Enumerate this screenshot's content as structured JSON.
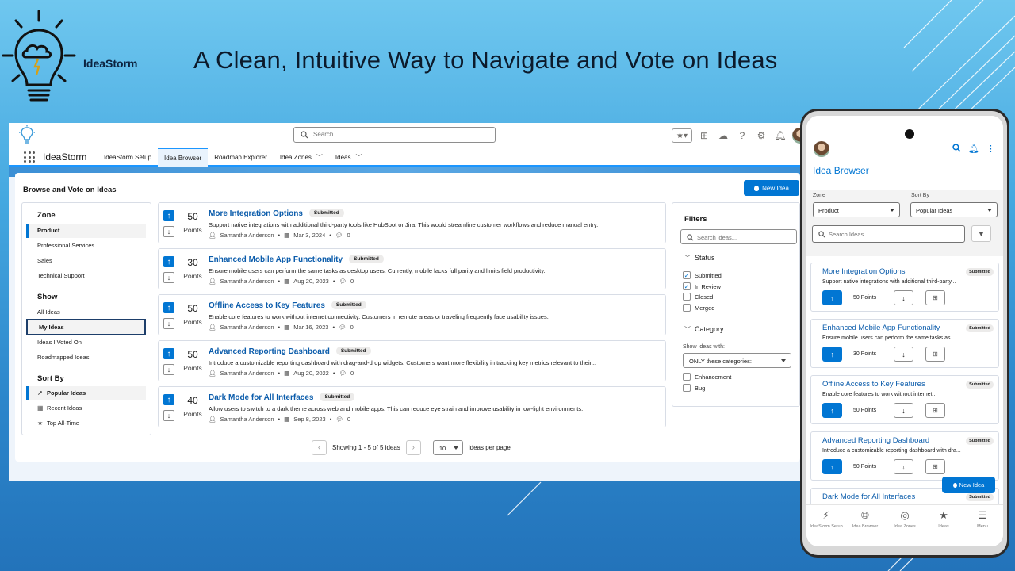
{
  "brand": {
    "name": "IdeaStorm",
    "logo_icon": "lightbulb-cloud-icon"
  },
  "headline": "A Clean, Intuitive Way to Navigate and Vote on Ideas",
  "desktop": {
    "search_placeholder": "Search...",
    "app_name": "IdeaStorm",
    "tabs": [
      {
        "label": "IdeaStorm Setup",
        "active": false
      },
      {
        "label": "Idea Browser",
        "active": true
      },
      {
        "label": "Roadmap Explorer",
        "active": false
      },
      {
        "label": "Idea Zones",
        "active": false,
        "dropdown": true
      },
      {
        "label": "Ideas",
        "active": false,
        "dropdown": true
      }
    ],
    "page_title": "Browse and Vote on Ideas",
    "new_idea_label": "New Idea",
    "zone": {
      "heading": "Zone",
      "items": [
        "Product",
        "Professional Services",
        "Sales",
        "Technical Support"
      ],
      "selected": "Product"
    },
    "show": {
      "heading": "Show",
      "items": [
        "All Ideas",
        "My Ideas",
        "Ideas I Voted On",
        "Roadmapped Ideas"
      ],
      "selected": "My Ideas"
    },
    "sort": {
      "heading": "Sort By",
      "items": [
        "Popular Ideas",
        "Recent Ideas",
        "Top All-Time"
      ],
      "selected": "Popular Ideas"
    },
    "ideas": [
      {
        "points": "50",
        "points_label": "Points",
        "title": "More Integration Options",
        "status": "Submitted",
        "description": "Support native integrations with additional third-party tools like HubSpot or Jira. This would streamline customer workflows and reduce manual entry.",
        "author": "Samantha Anderson",
        "date": "Mar 3, 2024",
        "comments": "0"
      },
      {
        "points": "30",
        "points_label": "Points",
        "title": "Enhanced Mobile App Functionality",
        "status": "Submitted",
        "description": "Ensure mobile users can perform the same tasks as desktop users. Currently, mobile lacks full parity and limits field productivity.",
        "author": "Samantha Anderson",
        "date": "Aug 20, 2023",
        "comments": "0"
      },
      {
        "points": "50",
        "points_label": "Points",
        "title": "Offline Access to Key Features",
        "status": "Submitted",
        "description": "Enable core features to work without internet connectivity. Customers in remote areas or traveling frequently face usability issues.",
        "author": "Samantha Anderson",
        "date": "Mar 16, 2023",
        "comments": "0"
      },
      {
        "points": "50",
        "points_label": "Points",
        "title": "Advanced Reporting Dashboard",
        "status": "Submitted",
        "description": "Introduce a customizable reporting dashboard with drag-and-drop widgets. Customers want more flexibility in tracking key metrics relevant to their...",
        "author": "Samantha Anderson",
        "date": "Aug 20, 2022",
        "comments": "0"
      },
      {
        "points": "40",
        "points_label": "Points",
        "title": "Dark Mode for All Interfaces",
        "status": "Submitted",
        "description": "Allow users to switch to a dark theme across web and mobile apps. This can reduce eye strain and improve usability in low-light environments.",
        "author": "Samantha Anderson",
        "date": "Sep 8, 2023",
        "comments": "0"
      }
    ],
    "pager": {
      "showing": "Showing 1 - 5 of 5 ideas",
      "per_page_value": "10",
      "per_page_label": "ideas per page"
    },
    "filters": {
      "heading": "Filters",
      "search_placeholder": "Search ideas...",
      "status_heading": "Status",
      "status_options": [
        {
          "label": "Submitted",
          "checked": true
        },
        {
          "label": "In Review",
          "checked": true
        },
        {
          "label": "Closed",
          "checked": false
        },
        {
          "label": "Merged",
          "checked": false
        }
      ],
      "category_heading": "Category",
      "show_with_label": "Show Ideas with:",
      "show_with_value": "ONLY these categories:",
      "category_options": [
        {
          "label": "Enhancement",
          "checked": false
        },
        {
          "label": "Bug",
          "checked": false
        }
      ]
    }
  },
  "mobile": {
    "title": "Idea Browser",
    "zone_label": "Zone",
    "zone_value": "Product",
    "sort_label": "Sort By",
    "sort_value": "Popular Ideas",
    "search_placeholder": "Search Ideas...",
    "ideas": [
      {
        "title": "More Integration Options",
        "status": "Submitted",
        "description": "Support native integrations with additional third-party...",
        "points": "50 Points"
      },
      {
        "title": "Enhanced Mobile App Functionality",
        "status": "Submitted",
        "description": "Ensure mobile users can perform the same tasks as...",
        "points": "30 Points"
      },
      {
        "title": "Offline Access to Key Features",
        "status": "Submitted",
        "description": "Enable core features to work without internet...",
        "points": "50 Points"
      },
      {
        "title": "Advanced Reporting Dashboard",
        "status": "Submitted",
        "description": "Introduce a customizable reporting dashboard with dra...",
        "points": "50 Points"
      },
      {
        "title": "Dark Mode for All Interfaces",
        "status": "Submitted"
      }
    ],
    "new_idea_label": "New Idea",
    "bottom_nav": [
      "IdeaStorm Setup",
      "Idea Browser",
      "Idea Zones",
      "Ideas",
      "Menu"
    ]
  },
  "colors": {
    "brand_blue": "#0176d3",
    "link_blue": "#0b5cab",
    "slide_bg": "#45a8e0"
  }
}
